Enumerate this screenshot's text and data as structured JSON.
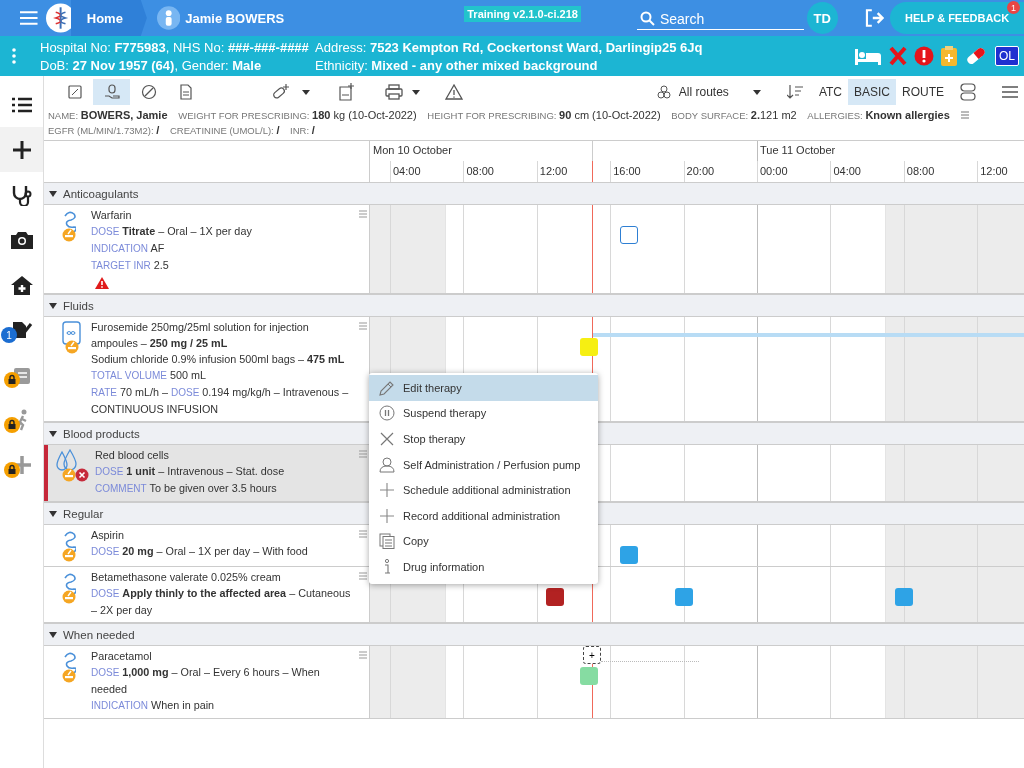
{
  "header": {
    "home": "Home",
    "patient": "Jamie BOWERS",
    "environment": "Training v2.1.0-ci.218",
    "search": "Search",
    "initials": "TD",
    "help": "HELP & FEEDBACK",
    "help_badge": "1"
  },
  "patient_bar": {
    "lines": [
      [
        "Hospital No: **F775983**, NHS No: **###-###-####**",
        "Address: **7523 Kempton Rd, Cockertonst Ward, Darlingip25 6Jq**"
      ],
      [
        "DoB: **27 Nov 1957 (64)**, Gender: **Male**",
        "Ethnicity: **Mixed - any other mixed background**"
      ]
    ],
    "badge": "OL"
  },
  "sidebar": {
    "items": [
      {
        "selected": false,
        "locked": false
      },
      {
        "selected": true,
        "locked": false
      },
      {
        "selected": false,
        "locked": false
      },
      {
        "selected": false,
        "locked": false
      },
      {
        "selected": false,
        "locked": false
      },
      {
        "selected": false,
        "locked": false,
        "badge": "1"
      },
      {
        "selected": false,
        "locked": true
      },
      {
        "selected": false,
        "locked": true
      },
      {
        "selected": false,
        "locked": true
      }
    ]
  },
  "toolbar": {
    "view_tabs": [
      {
        "selected": false
      },
      {
        "selected": true
      },
      {
        "selected": false
      },
      {
        "selected": false
      }
    ],
    "routes": "All routes",
    "sort_modes": [
      {
        "label": "ATC",
        "selected": false
      },
      {
        "label": "BASIC",
        "selected": true
      },
      {
        "label": "ROUTE",
        "selected": false
      }
    ]
  },
  "summary": [
    {
      "label": "NAME:",
      "value": "**BOWERS, Jamie**"
    },
    {
      "label": "WEIGHT FOR PRESCRIBING:",
      "value": "**180** kg (10-Oct-2022)"
    },
    {
      "label": "HEIGHT FOR PRESCRIBING:",
      "value": "**90** cm (10-Oct-2022)"
    },
    {
      "label": "BODY SURFACE:",
      "value": "**2.**121 m2"
    },
    {
      "label": "ALLERGIES:",
      "value": "**Known allergies**",
      "menu": true
    },
    {
      "label": "EGFR (ML/MIN/1.73M2):",
      "value": "**/**"
    },
    {
      "label": "CREATININE (UMOL/L):",
      "value": "**/**"
    },
    {
      "label": "INR:",
      "value": "**/**"
    }
  ],
  "timeline": {
    "days": [
      {
        "label": "Mon 10 October"
      },
      {
        "label": "Tue 11 October"
      }
    ],
    "ticks": [
      "04:00",
      "08:00",
      "12:00",
      "16:00",
      "20:00",
      "00:00",
      "04:00",
      "08:00",
      "12:00"
    ]
  },
  "groups": [
    {
      "title": "Anticoagulants",
      "expanded": true,
      "items": [
        {
          "name": "Warfarin",
          "kind": "oral",
          "warning": true,
          "highlighted": false,
          "cancelled": false,
          "lines": [
            [
              {
                "kind": "label",
                "text": "DOSE"
              },
              {
                "kind": "text",
                "text": "**Titrate** – Oral – 1X per day"
              }
            ],
            [
              {
                "kind": "label",
                "text": "INDICATION"
              },
              {
                "kind": "text",
                "text": "AF"
              }
            ],
            [
              {
                "kind": "label",
                "text": "TARGET INR"
              },
              {
                "kind": "text",
                "text": "2.5"
              }
            ]
          ],
          "marks": [
            {
              "kind": "planned"
            }
          ]
        }
      ]
    },
    {
      "title": "Fluids",
      "expanded": true,
      "items": [
        {
          "name": "Furosemide 250mg/25ml solution for injection ampoules – **250 mg / 25 mL**",
          "kind": "infusion",
          "warning": false,
          "highlighted": false,
          "cancelled": false,
          "lines": [
            [
              {
                "kind": "text",
                "text": "Sodium chloride 0.9% infusion 500ml bags – **475 mL**"
              }
            ],
            [
              {
                "kind": "label",
                "text": "TOTAL VOLUME"
              },
              {
                "kind": "text",
                "text": "500 mL"
              }
            ],
            [
              {
                "kind": "label",
                "text": "RATE"
              },
              {
                "kind": "text",
                "text": "70 mL/h –"
              },
              {
                "kind": "label",
                "text": "DOSE"
              },
              {
                "kind": "text",
                "text": "0.194 mg/kg/h – Intravenous – CONTINUOUS INFUSION"
              }
            ]
          ],
          "marks": [
            {
              "kind": "due"
            }
          ],
          "infusion_running": true
        }
      ]
    },
    {
      "title": "Blood products",
      "expanded": true,
      "items": [
        {
          "name": "Red blood cells",
          "kind": "blood",
          "warning": false,
          "highlighted": true,
          "cancelled": true,
          "lines": [
            [
              {
                "kind": "label",
                "text": "DOSE"
              },
              {
                "kind": "text",
                "text": "**1 unit** – Intravenous – Stat. dose"
              }
            ],
            [
              {
                "kind": "label",
                "text": "COMMENT"
              },
              {
                "kind": "text",
                "text": "To be given over 3.5 hours"
              }
            ]
          ]
        }
      ]
    },
    {
      "title": "Regular",
      "expanded": true,
      "items": [
        {
          "name": "Aspirin",
          "kind": "oral",
          "warning": false,
          "highlighted": false,
          "cancelled": false,
          "lines": [
            [
              {
                "kind": "label",
                "text": "DOSE"
              },
              {
                "kind": "text",
                "text": "**20 mg** – Oral – 1X per day – With food"
              }
            ]
          ],
          "marks": [
            {
              "kind": "given"
            }
          ]
        },
        {
          "name": "Betamethasone valerate 0.025% cream",
          "kind": "oral",
          "warning": false,
          "highlighted": false,
          "cancelled": false,
          "lines": [
            [
              {
                "kind": "label",
                "text": "DOSE"
              },
              {
                "kind": "text",
                "text": "**Apply thinly to the affected area** – Cutaneous – 2X per day"
              }
            ]
          ],
          "marks": [
            {
              "kind": "missed"
            },
            {
              "kind": "given"
            },
            {
              "kind": "given"
            }
          ]
        }
      ]
    },
    {
      "title": "When needed",
      "expanded": true,
      "items": [
        {
          "name": "Paracetamol",
          "kind": "oral",
          "warning": false,
          "highlighted": false,
          "cancelled": false,
          "lines": [
            [
              {
                "kind": "label",
                "text": "DOSE"
              },
              {
                "kind": "text",
                "text": "**1,000 mg** – Oral – Every 6 hours – When needed"
              }
            ],
            [
              {
                "kind": "label",
                "text": "INDICATION"
              },
              {
                "kind": "text",
                "text": "When in pain"
              }
            ]
          ],
          "marks": [
            {
              "kind": "prn"
            }
          ],
          "add_marker": "+"
        }
      ]
    }
  ],
  "context_menu": [
    {
      "label": "Edit therapy",
      "selected": true
    },
    {
      "label": "Suspend therapy",
      "selected": false
    },
    {
      "label": "Stop therapy",
      "selected": false
    },
    {
      "label": "Self Administration / Perfusion pump",
      "selected": false
    },
    {
      "label": "Schedule additional administration",
      "selected": false
    },
    {
      "label": "Record additional administration",
      "selected": false
    },
    {
      "label": "Copy",
      "selected": false
    },
    {
      "label": "Drug information",
      "selected": false
    }
  ]
}
